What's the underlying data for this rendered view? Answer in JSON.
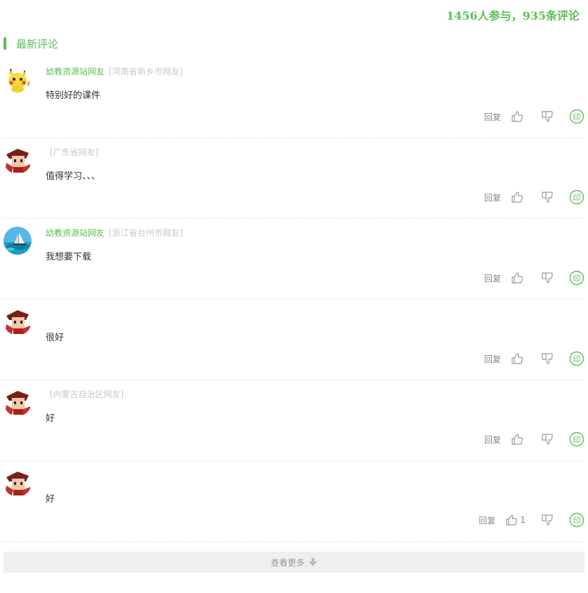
{
  "header": {
    "stats": "1456人参与，935条评论"
  },
  "section": {
    "title": "最新评论"
  },
  "comments": [
    {
      "avatar": "pikachu-avatar",
      "nick": "幼教资源站网友",
      "region": "[河南省新乡市网友]",
      "text": "特别好的课件",
      "reply": "回复",
      "likes": ""
    },
    {
      "avatar": "cartoon-avatar",
      "nick": "",
      "region": "[广东省网友]",
      "text": "值得学习、、、",
      "reply": "回复",
      "likes": ""
    },
    {
      "avatar": "ocean-avatar",
      "nick": "幼教资源站网友",
      "region": "[浙江省台州市网友]",
      "text": "我想要下载",
      "reply": "回复",
      "likes": ""
    },
    {
      "avatar": "cartoon-avatar",
      "nick": "",
      "region": "",
      "text": "很好",
      "reply": "回复",
      "likes": ""
    },
    {
      "avatar": "cartoon-avatar",
      "nick": "",
      "region": "[内蒙古自治区网友]",
      "text": "好",
      "reply": "回复",
      "likes": ""
    },
    {
      "avatar": "cartoon-avatar",
      "nick": "",
      "region": "",
      "text": "好",
      "reply": "回复",
      "likes": "1"
    }
  ],
  "more": {
    "label": "查看更多"
  },
  "colors": {
    "accent": "#5cbf56",
    "muted": "#888888",
    "region": "#c8c8c8"
  }
}
